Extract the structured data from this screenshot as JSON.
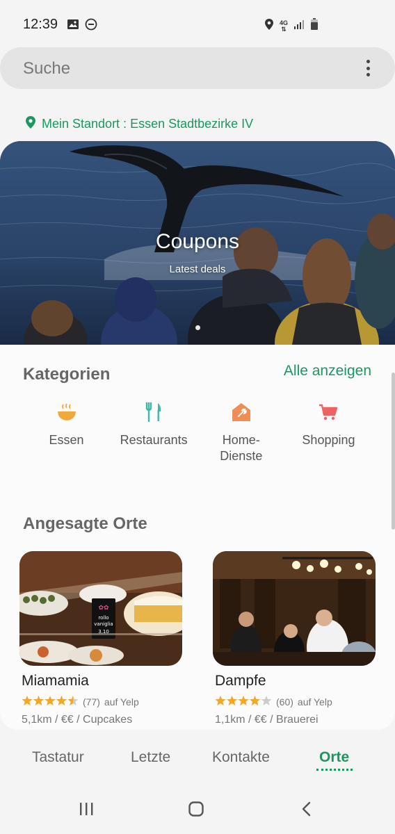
{
  "status_bar": {
    "time": "12:39",
    "network": "4G",
    "left_icons": [
      "image-icon",
      "do-not-disturb-icon"
    ],
    "right_icons": [
      "location-icon",
      "network-icon",
      "signal-icon",
      "battery-icon"
    ]
  },
  "search": {
    "placeholder": "Suche"
  },
  "location": {
    "text": "Mein Standort : Essen Stadtbezirke IV"
  },
  "banner": {
    "title": "Coupons",
    "subtitle": "Latest deals",
    "active_slide": 1
  },
  "categories": {
    "title": "Kategorien",
    "see_all": "Alle anzeigen",
    "items": [
      {
        "label": "Essen",
        "icon": "food-bowl-icon",
        "color": "#f0a93b"
      },
      {
        "label": "Restaurants",
        "icon": "fork-knife-icon",
        "color": "#3fb8a8"
      },
      {
        "label": "Home-\nDienste",
        "icon": "home-repair-icon",
        "color": "#f08c54"
      },
      {
        "label": "Shopping",
        "icon": "shopping-cart-icon",
        "color": "#ee6262"
      }
    ]
  },
  "trending": {
    "title": "Angesagte Orte",
    "places": [
      {
        "name": "Miamamia",
        "rating": 4.5,
        "reviews": "(77)",
        "source": "auf Yelp",
        "meta": "5,1km / €€ / Cupcakes",
        "sign_text": "rollo\nvaniglia\n3,10"
      },
      {
        "name": "Dampfe",
        "rating": 4,
        "reviews": "(60)",
        "source": "auf Yelp",
        "meta": "1,1km / €€ / Brauerei"
      }
    ]
  },
  "tabs": [
    {
      "label": "Tastatur",
      "active": false
    },
    {
      "label": "Letzte",
      "active": false
    },
    {
      "label": "Kontakte",
      "active": false
    },
    {
      "label": "Orte",
      "active": true
    }
  ],
  "colors": {
    "accent": "#1c9760",
    "star": "#f5a623",
    "star_empty": "#cccccc"
  }
}
